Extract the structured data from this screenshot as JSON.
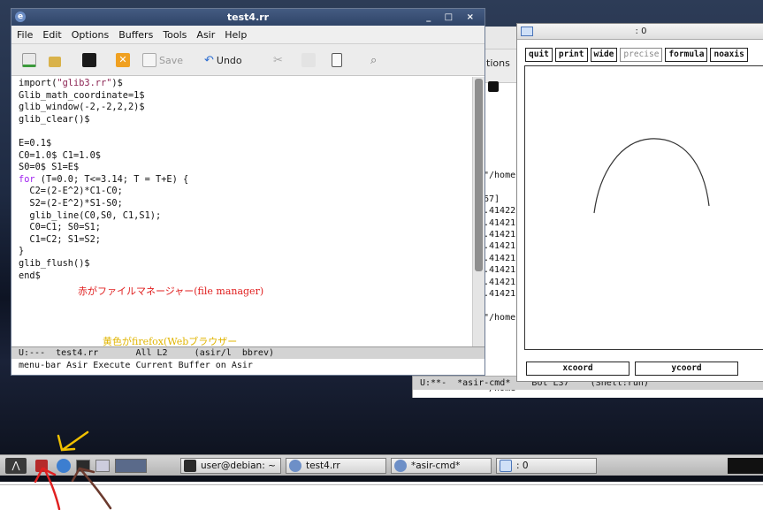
{
  "asir_window": {
    "options_fragment": "tions",
    "output_lines": [
      "\"/home",
      "",
      "67]",
      ".41422",
      ".41421",
      ".41421",
      ".41421",
      ".41421",
      ".41421",
      ".41421",
      ".41421",
      "",
      "\"/home",
      "",
      "",
      "",
      "",
      "",
      "\"/home"
    ],
    "status": "U:**-  *asir-cmd*    Bot L37    (Shell:run)"
  },
  "editor": {
    "title": "test4.rr",
    "window_controls": "_ □ ×",
    "menu": [
      "File",
      "Edit",
      "Options",
      "Buffers",
      "Tools",
      "Asir",
      "Help"
    ],
    "toolbar": {
      "save_label": "Save",
      "undo_label": "Undo"
    },
    "code": {
      "l1a": "import(",
      "l1b": "\"glib3.rr\"",
      "l1c": ")$",
      "l2": "Glib_math_coordinate=1$",
      "l3": "glib_window(-2,-2,2,2)$",
      "l4": "glib_clear()$",
      "l5": "",
      "l6": "E=0.1$",
      "l7": "C0=1.0$ C1=1.0$",
      "l8": "S0=0$ S1=E$",
      "l9a": "for",
      "l9b": " (T=0.0; T<=3.14; T = T+E) {",
      "l10": "  C2=(2-E^2)*C1-C0;",
      "l11": "  S2=(2-E^2)*S1-S0;",
      "l12": "  glib_line(C0,S0, C1,S1);",
      "l13": "  C0=C1; S0=S1;",
      "l14": "  C1=C2; S1=S2;",
      "l15": "}",
      "l16": "glib_flush()$",
      "l17": "end$"
    },
    "mode_line": "U:---  test4.rr       All L2     (asir/l  bbrev)",
    "minibuffer": "menu-bar Asir Execute Current Buffer on Asir",
    "annotation_red": "赤がファイルマネージャー(file manager)",
    "annotation_yellow": "黄色がfirefox(Webブラウザー"
  },
  "plot_window": {
    "title": ": 0",
    "buttons": [
      "quit",
      "print",
      "wide",
      "precise",
      "formula",
      "noaxis"
    ],
    "coord_buttons": [
      "xcoord",
      "ycoord"
    ]
  },
  "taskbar": {
    "items": [
      {
        "label": "user@debian: ~"
      },
      {
        "label": "test4.rr"
      },
      {
        "label": "*asir-cmd*"
      },
      {
        "label": ": 0"
      }
    ]
  },
  "colors": {
    "annotation_red": "#e02020",
    "annotation_yellow": "#e0b400",
    "annotation_brown": "#6b3a2e",
    "keyword": "#a020f0",
    "string": "#8b2252"
  }
}
